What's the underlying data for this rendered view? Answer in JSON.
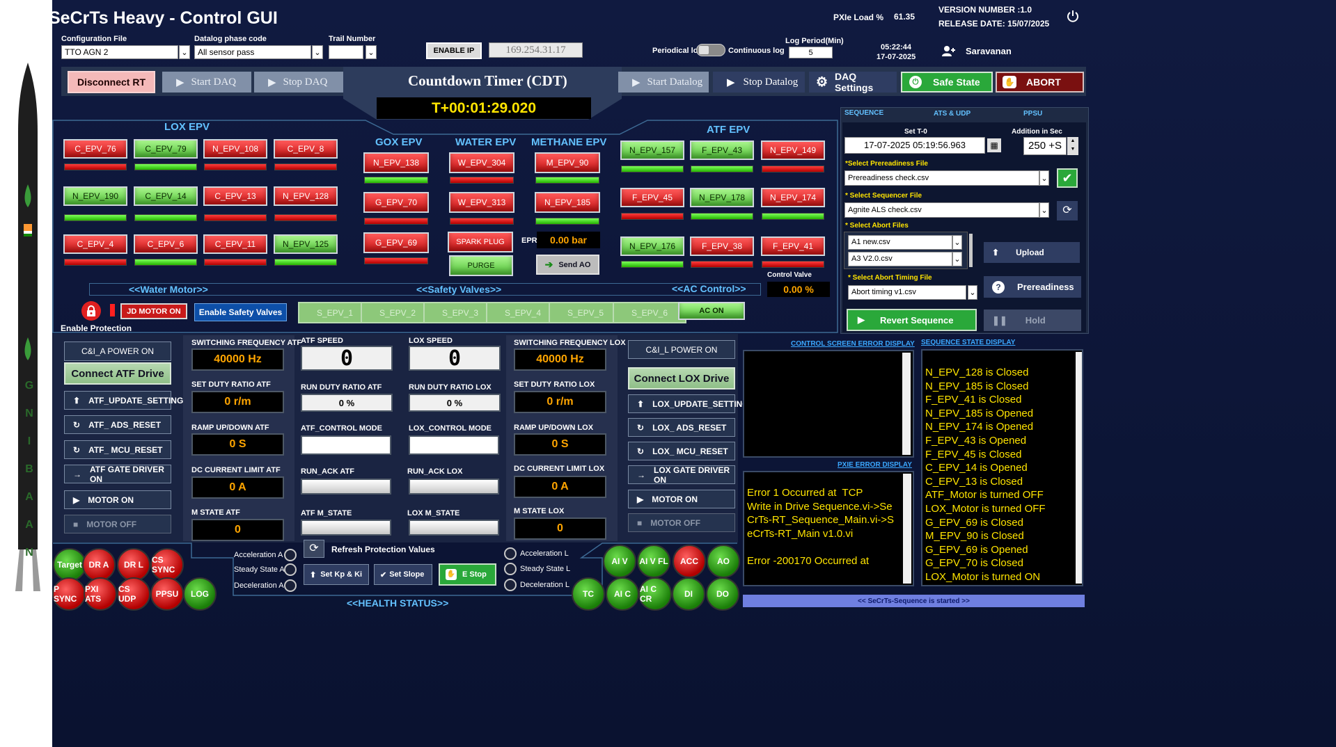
{
  "app": {
    "title": "SeCrTs Heavy - Control GUI",
    "pxie_load_label": "PXIe Load %",
    "pxie_load_value": "61.35",
    "version": "VERSION NUMBER :1.0",
    "release": "RELEASE DATE: 15/07/2025",
    "time": "05:22:44",
    "date": "17-07-2025",
    "user": "Saravanan",
    "rocket_text": [
      "G",
      "N",
      "I",
      "B",
      "A",
      "A",
      "N"
    ]
  },
  "config": {
    "config_label": "Configuration File",
    "config_value": "TTO AGN 2",
    "datalog_label": "Datalog phase code",
    "datalog_value": "All sensor pass",
    "trail_label": "Trail Number",
    "trail_value": "",
    "enable_ip": "ENABLE IP",
    "ip": "169.254.31.17",
    "periodical": "Periodical log",
    "continuous": "Continuous log",
    "log_period_label": "Log Period(Min)",
    "log_period_value": "5"
  },
  "toolbar": {
    "disconnect": "Disconnect RT",
    "start_daq": "Start DAQ",
    "stop_daq": "Stop DAQ",
    "cdt_title": "Countdown Timer (CDT)",
    "cdt_value": "T+00:01:29.020",
    "start_datalog": "Start Datalog",
    "stop_datalog": "Stop Datalog",
    "daq_settings": "DAQ Settings",
    "safe_state": "Safe State",
    "abort": "ABORT"
  },
  "groups": {
    "lox": "LOX EPV",
    "gox": "GOX EPV",
    "water": "WATER EPV",
    "methane": "METHANE EPV",
    "atf": "ATF EPV"
  },
  "epv": [
    {
      "name": "C_EPV_76",
      "state": "red",
      "ind": "red"
    },
    {
      "name": "C_EPV_79",
      "state": "green",
      "ind": "green"
    },
    {
      "name": "N_EPV_108",
      "state": "red",
      "ind": "red"
    },
    {
      "name": "C_EPV_8",
      "state": "red",
      "ind": "red"
    },
    {
      "name": "N_EPV_190",
      "state": "green",
      "ind": "green"
    },
    {
      "name": "C_EPV_14",
      "state": "green",
      "ind": "green"
    },
    {
      "name": "C_EPV_13",
      "state": "red",
      "ind": "red"
    },
    {
      "name": "N_EPV_128",
      "state": "red",
      "ind": "red"
    },
    {
      "name": "C_EPV_4",
      "state": "red",
      "ind": "red"
    },
    {
      "name": "C_EPV_6",
      "state": "red",
      "ind": "green"
    },
    {
      "name": "C_EPV_11",
      "state": "red",
      "ind": "red"
    },
    {
      "name": "N_EPV_125",
      "state": "green",
      "ind": "green"
    },
    {
      "name": "N_EPV_138",
      "state": "red",
      "ind": "green"
    },
    {
      "name": "G_EPV_70",
      "state": "red",
      "ind": "red"
    },
    {
      "name": "G_EPV_69",
      "state": "red",
      "ind": "red"
    },
    {
      "name": "W_EPV_304",
      "state": "red",
      "ind": "red"
    },
    {
      "name": "W_EPV_313",
      "state": "red",
      "ind": "red"
    },
    {
      "name": "M_EPV_90",
      "state": "red",
      "ind": "green"
    },
    {
      "name": "N_EPV_185",
      "state": "red",
      "ind": "green"
    },
    {
      "name": "N_EPV_157",
      "state": "green",
      "ind": "green"
    },
    {
      "name": "F_EPV_43",
      "state": "green",
      "ind": "green"
    },
    {
      "name": "N_EPV_149",
      "state": "red",
      "ind": "red"
    },
    {
      "name": "F_EPV_45",
      "state": "red",
      "ind": "red"
    },
    {
      "name": "N_EPV_178",
      "state": "green",
      "ind": "green"
    },
    {
      "name": "N_EPV_174",
      "state": "red",
      "ind": "green"
    },
    {
      "name": "N_EPV_176",
      "state": "green",
      "ind": "green"
    },
    {
      "name": "F_EPV_38",
      "state": "red",
      "ind": "red"
    },
    {
      "name": "F_EPV_41",
      "state": "red",
      "ind": "red"
    }
  ],
  "mid": {
    "spark_plug": "SPARK PLUG",
    "purge": "PURGE",
    "epr_label": "EPR",
    "epr_value": "0.00 bar",
    "send_ao": "Send AO",
    "control_valve_label": "Control Valve",
    "control_valve_value": "0.00 %"
  },
  "motor": {
    "water_motor": "<<Water Motor>>",
    "safety_valves": "<<Safety Valves>>",
    "ac_control": "<<AC Control>>",
    "jd_motor": "JD MOTOR ON",
    "enable_safety": "Enable Safety Valves",
    "sv": [
      "S_EPV_1",
      "S_EPV_2",
      "S_EPV_3",
      "S_EPV_4",
      "S_EPV_5",
      "S_EPV_6"
    ],
    "ac_on": "AC ON",
    "enable_protection": "Enable Protection"
  },
  "right": {
    "tabs": [
      "SEQUENCE",
      "ATS & UDP",
      "PPSU"
    ],
    "set_t0_label": "Set T-0",
    "set_t0_value": "17-07-2025 05:19:56.963",
    "addition_label": "Addition in Sec",
    "addition_value": "250 +S",
    "prereadiness_label": "*Select Prereadiness File",
    "prereadiness_value": "Prereadiness check.csv",
    "sequencer_label": "* Select Sequencer File",
    "sequencer_value": "Agnite ALS check.csv",
    "abort_files_label": "* Select Abort Files",
    "abort_files": [
      "A1 new.csv",
      "A3 V2.0.csv"
    ],
    "upload": "Upload",
    "abort_timing_label": "* Select Abort Timing File",
    "abort_timing_value": "Abort timing v1.csv",
    "prereadiness_btn": "Prereadiness",
    "revert": "Revert Sequence",
    "hold": "Hold"
  },
  "atf": {
    "power": "C&I_A POWER ON",
    "connect": "Connect ATF Drive",
    "update": "ATF_UPDATE_SETTINGS",
    "ads_reset": "ATF_ ADS_RESET",
    "mcu_reset": "ATF_ MCU_RESET",
    "gate": "ATF GATE DRIVER ON",
    "motor_on": "MOTOR ON",
    "motor_off": "MOTOR OFF",
    "sw_freq_label": "SWITCHING FREQUENCY ATF",
    "sw_freq": "40000 Hz",
    "duty_label": "SET DUTY RATIO ATF",
    "duty": "0 r/m",
    "ramp_label": "RAMP UP/DOWN ATF",
    "ramp": "0 S",
    "dc_label": "DC CURRENT LIMIT ATF",
    "dc": "0 A",
    "mstate_label": "M STATE ATF",
    "mstate": "0",
    "speed_label": "ATF SPEED",
    "speed": "0",
    "run_duty_label": "RUN DUTY RATIO ATF",
    "run_duty": "0 %",
    "ctrl_label": "ATF_CONTROL MODE",
    "ack_label": "RUN_ACK ATF",
    "mstate2_label": "ATF M_STATE"
  },
  "lox": {
    "power": "C&I_L POWER ON",
    "connect": "Connect LOX Drive",
    "update": "LOX_UPDATE_SETTINGS",
    "ads_reset": "LOX_ ADS_RESET",
    "mcu_reset": "LOX_ MCU_RESET",
    "gate": "LOX GATE DRIVER ON",
    "motor_on": "MOTOR ON",
    "motor_off": "MOTOR OFF",
    "sw_freq_label": "SWITCHING FREQUENCY LOX",
    "sw_freq": "40000 Hz",
    "duty_label": "SET DUTY RATIO LOX",
    "duty": "0 r/m",
    "ramp_label": "RAMP UP/DOWN LOX",
    "ramp": "0 S",
    "dc_label": "DC CURRENT LIMIT LOX",
    "dc": "0 A",
    "mstate_label": "M STATE LOX",
    "mstate": "0",
    "speed_label": "LOX SPEED",
    "speed": "0",
    "run_duty_label": "RUN DUTY RATIO LOX",
    "run_duty": "0 %",
    "ctrl_label": "LOX_CONTROL MODE",
    "ack_label": "RUN_ACK LOX",
    "mstate2_label": "LOX M_STATE"
  },
  "bottom": {
    "refresh": "Refresh Protection Values",
    "accel_a": "Acceleration A",
    "steady_a": "Steady State A",
    "decel_a": "Deceleration A",
    "accel_l": "Acceleration L",
    "steady_l": "Steady State L",
    "decel_l": "Deceleration L",
    "set_kp": "Set Kp & Ki",
    "set_slope": "Set Slope",
    "estop": "E Stop",
    "health": "<<HEALTH STATUS>>",
    "left_leds": [
      {
        "l": "Target",
        "c": "green"
      },
      {
        "l": "DR A",
        "c": "red"
      },
      {
        "l": "DR L",
        "c": "red"
      },
      {
        "l": "CS SYNC",
        "c": "red"
      },
      {
        "l": "P SYNC",
        "c": "red"
      },
      {
        "l": "PXI ATS",
        "c": "red"
      },
      {
        "l": "CS UDP",
        "c": "red"
      },
      {
        "l": "PPSU",
        "c": "red"
      },
      {
        "l": "LOG",
        "c": "green"
      }
    ],
    "right_leds": [
      {
        "l": "AI V",
        "c": "green"
      },
      {
        "l": "AI V FL",
        "c": "green"
      },
      {
        "l": "ACC",
        "c": "red"
      },
      {
        "l": "AO",
        "c": "green"
      },
      {
        "l": "TC",
        "c": "green"
      },
      {
        "l": "AI C",
        "c": "green"
      },
      {
        "l": "AI C CR",
        "c": "green"
      },
      {
        "l": "DI",
        "c": "green"
      },
      {
        "l": "DO",
        "c": "green"
      }
    ]
  },
  "displays": {
    "ctrl_err_title": "CONTROL SCREEN ERROR DISPLAY",
    "seq_state_title": "SEQUENCE STATE DISPLAY",
    "pxie_err_title": "PXIE ERROR DISPLAY",
    "pxie_err_text": "Error 1 Occurred at  TCP\nWrite in Drive Sequence.vi->SeCrTs-RT_Sequence_Main.vi->SeCrTs-RT_Main v1.0.vi\n\nError -200170 Occurred at",
    "seq_lines": [
      "N_EPV_128 is Closed",
      "N_EPV_185 is Closed",
      "F_EPV_41 is Closed",
      "N_EPV_185 is Opened",
      "N_EPV_174 is Opened",
      "F_EPV_43 is Opened",
      "F_EPV_45 is Closed",
      "C_EPV_14 is Opened",
      "C_EPV_13 is Closed",
      "ATF_Motor is turned OFF",
      "LOX_Motor is turned OFF",
      "G_EPV_69 is Closed",
      "M_EPV_90 is Closed",
      "G_EPV_69 is Opened",
      "G_EPV_70 is Closed",
      "LOX_Motor is turned ON"
    ],
    "status": "<< SeCrTs-Sequence is started >>"
  }
}
